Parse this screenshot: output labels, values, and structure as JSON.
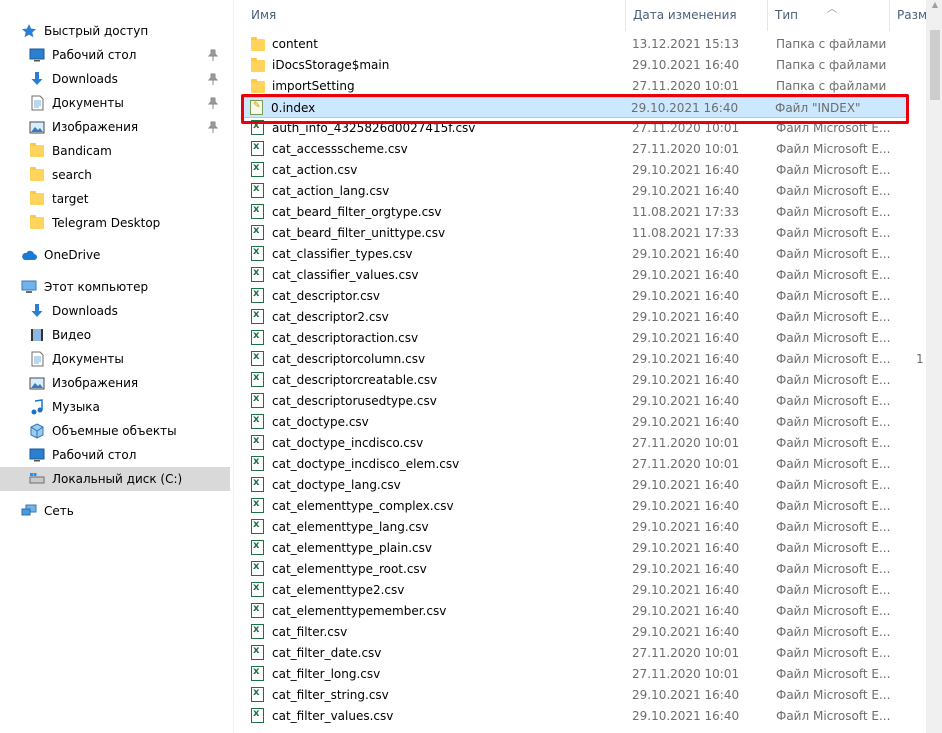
{
  "nav": {
    "quick_access": {
      "label": "Быстрый доступ",
      "icon": "star-icon"
    },
    "quick_items": [
      {
        "label": "Рабочий стол",
        "icon": "desktop-icon",
        "pinned": true
      },
      {
        "label": "Downloads",
        "icon": "download-arrow-icon",
        "pinned": true
      },
      {
        "label": "Документы",
        "icon": "document-icon",
        "pinned": true
      },
      {
        "label": "Изображения",
        "icon": "pictures-icon",
        "pinned": true
      },
      {
        "label": "Bandicam",
        "icon": "folder-icon"
      },
      {
        "label": "search",
        "icon": "folder-icon"
      },
      {
        "label": "target",
        "icon": "folder-icon"
      },
      {
        "label": "Telegram Desktop",
        "icon": "folder-icon"
      }
    ],
    "onedrive": {
      "label": "OneDrive",
      "icon": "cloud-icon"
    },
    "this_pc": {
      "label": "Этот компьютер",
      "icon": "computer-icon"
    },
    "pc_items": [
      {
        "label": "Downloads",
        "icon": "download-arrow-icon"
      },
      {
        "label": "Видео",
        "icon": "video-icon"
      },
      {
        "label": "Документы",
        "icon": "document-icon"
      },
      {
        "label": "Изображения",
        "icon": "pictures-icon"
      },
      {
        "label": "Музыка",
        "icon": "music-icon"
      },
      {
        "label": "Объемные объекты",
        "icon": "3d-objects-icon"
      },
      {
        "label": "Рабочий стол",
        "icon": "desktop-icon"
      },
      {
        "label": "Локальный диск (C:)",
        "icon": "drive-icon",
        "selected": true
      }
    ],
    "network": {
      "label": "Сеть",
      "icon": "network-icon"
    }
  },
  "columns": {
    "name": "Имя",
    "date": "Дата изменения",
    "type": "Тип",
    "size": "Разме"
  },
  "files": [
    {
      "name": "content",
      "date": "13.12.2021 15:13",
      "type": "Папка с файлами",
      "kind": "folder"
    },
    {
      "name": "iDocsStorage$main",
      "date": "29.10.2021 16:40",
      "type": "Папка с файлами",
      "kind": "folder"
    },
    {
      "name": "importSetting",
      "date": "27.11.2020 10:01",
      "type": "Папка с файлами",
      "kind": "folder"
    },
    {
      "name": "0.index",
      "date": "29.10.2021 16:40",
      "type": "Файл \"INDEX\"",
      "kind": "index",
      "selected": true
    },
    {
      "name": "auth_info_4325826d0027415f.csv",
      "date": "27.11.2020 10:01",
      "type": "Файл Microsoft E...",
      "kind": "csv"
    },
    {
      "name": "cat_accessscheme.csv",
      "date": "27.11.2020 10:01",
      "type": "Файл Microsoft E...",
      "kind": "csv"
    },
    {
      "name": "cat_action.csv",
      "date": "29.10.2021 16:40",
      "type": "Файл Microsoft E...",
      "kind": "csv"
    },
    {
      "name": "cat_action_lang.csv",
      "date": "29.10.2021 16:40",
      "type": "Файл Microsoft E...",
      "kind": "csv"
    },
    {
      "name": "cat_beard_filter_orgtype.csv",
      "date": "11.08.2021 17:33",
      "type": "Файл Microsoft E...",
      "kind": "csv"
    },
    {
      "name": "cat_beard_filter_unittype.csv",
      "date": "11.08.2021 17:33",
      "type": "Файл Microsoft E...",
      "kind": "csv"
    },
    {
      "name": "cat_classifier_types.csv",
      "date": "29.10.2021 16:40",
      "type": "Файл Microsoft E...",
      "kind": "csv"
    },
    {
      "name": "cat_classifier_values.csv",
      "date": "29.10.2021 16:40",
      "type": "Файл Microsoft E...",
      "kind": "csv"
    },
    {
      "name": "cat_descriptor.csv",
      "date": "29.10.2021 16:40",
      "type": "Файл Microsoft E...",
      "kind": "csv"
    },
    {
      "name": "cat_descriptor2.csv",
      "date": "29.10.2021 16:40",
      "type": "Файл Microsoft E...",
      "kind": "csv"
    },
    {
      "name": "cat_descriptoraction.csv",
      "date": "29.10.2021 16:40",
      "type": "Файл Microsoft E...",
      "kind": "csv"
    },
    {
      "name": "cat_descriptorcolumn.csv",
      "date": "29.10.2021 16:40",
      "type": "Файл Microsoft E...",
      "kind": "csv",
      "size": "1"
    },
    {
      "name": "cat_descriptorcreatable.csv",
      "date": "29.10.2021 16:40",
      "type": "Файл Microsoft E...",
      "kind": "csv"
    },
    {
      "name": "cat_descriptorusedtype.csv",
      "date": "29.10.2021 16:40",
      "type": "Файл Microsoft E...",
      "kind": "csv"
    },
    {
      "name": "cat_doctype.csv",
      "date": "29.10.2021 16:40",
      "type": "Файл Microsoft E...",
      "kind": "csv"
    },
    {
      "name": "cat_doctype_incdisco.csv",
      "date": "27.11.2020 10:01",
      "type": "Файл Microsoft E...",
      "kind": "csv"
    },
    {
      "name": "cat_doctype_incdisco_elem.csv",
      "date": "27.11.2020 10:01",
      "type": "Файл Microsoft E...",
      "kind": "csv"
    },
    {
      "name": "cat_doctype_lang.csv",
      "date": "29.10.2021 16:40",
      "type": "Файл Microsoft E...",
      "kind": "csv"
    },
    {
      "name": "cat_elementtype_complex.csv",
      "date": "29.10.2021 16:40",
      "type": "Файл Microsoft E...",
      "kind": "csv"
    },
    {
      "name": "cat_elementtype_lang.csv",
      "date": "29.10.2021 16:40",
      "type": "Файл Microsoft E...",
      "kind": "csv"
    },
    {
      "name": "cat_elementtype_plain.csv",
      "date": "29.10.2021 16:40",
      "type": "Файл Microsoft E...",
      "kind": "csv"
    },
    {
      "name": "cat_elementtype_root.csv",
      "date": "29.10.2021 16:40",
      "type": "Файл Microsoft E...",
      "kind": "csv"
    },
    {
      "name": "cat_elementtype2.csv",
      "date": "29.10.2021 16:40",
      "type": "Файл Microsoft E...",
      "kind": "csv"
    },
    {
      "name": "cat_elementtypemember.csv",
      "date": "29.10.2021 16:40",
      "type": "Файл Microsoft E...",
      "kind": "csv"
    },
    {
      "name": "cat_filter.csv",
      "date": "29.10.2021 16:40",
      "type": "Файл Microsoft E...",
      "kind": "csv"
    },
    {
      "name": "cat_filter_date.csv",
      "date": "27.11.2020 10:01",
      "type": "Файл Microsoft E...",
      "kind": "csv"
    },
    {
      "name": "cat_filter_long.csv",
      "date": "27.11.2020 10:01",
      "type": "Файл Microsoft E...",
      "kind": "csv"
    },
    {
      "name": "cat_filter_string.csv",
      "date": "29.10.2021 16:40",
      "type": "Файл Microsoft E...",
      "kind": "csv"
    },
    {
      "name": "cat_filter_values.csv",
      "date": "29.10.2021 16:40",
      "type": "Файл Microsoft E...",
      "kind": "csv"
    }
  ],
  "colors": {
    "selection_bg": "#cce8ff",
    "selection_border": "#99d1ff",
    "highlight": "#e8000b",
    "header_text": "#4c607a"
  }
}
